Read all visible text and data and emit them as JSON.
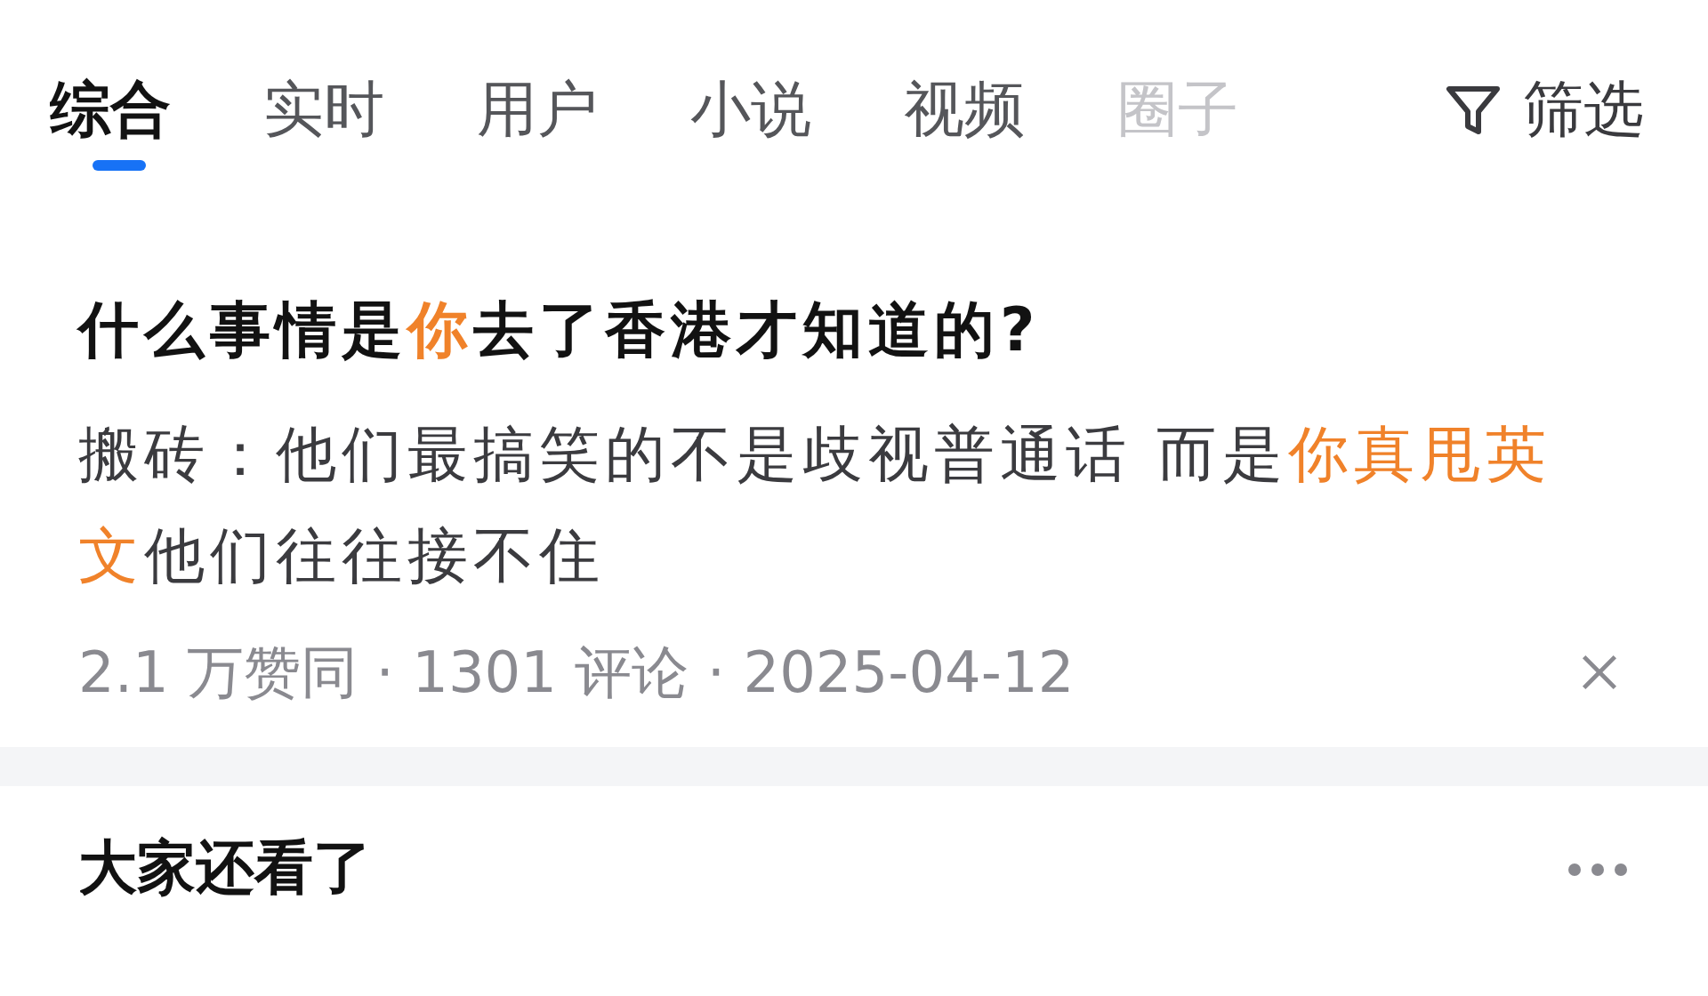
{
  "tabs": [
    {
      "label": "综合",
      "selected": true
    },
    {
      "label": "实时",
      "selected": false
    },
    {
      "label": "用户",
      "selected": false
    },
    {
      "label": "小说",
      "selected": false
    },
    {
      "label": "视频",
      "selected": false
    },
    {
      "label": "圈子",
      "selected": false,
      "faded": true
    }
  ],
  "filter": {
    "label": "筛选"
  },
  "result": {
    "title": [
      {
        "text": "什么事情是",
        "highlight": false
      },
      {
        "text": "你",
        "highlight": true
      },
      {
        "text": "去了香港才知道的?",
        "highlight": false
      }
    ],
    "snippet": [
      {
        "text": "搬砖：他们最搞笑的不是歧视普通话 而是",
        "highlight": false
      },
      {
        "text": "你真甩英文",
        "highlight": true
      },
      {
        "text": "他们往往接不住",
        "highlight": false
      }
    ],
    "meta": "2.1 万赞同 · 1301 评论 · 2025-04-12"
  },
  "related": {
    "title": "大家还看了"
  }
}
